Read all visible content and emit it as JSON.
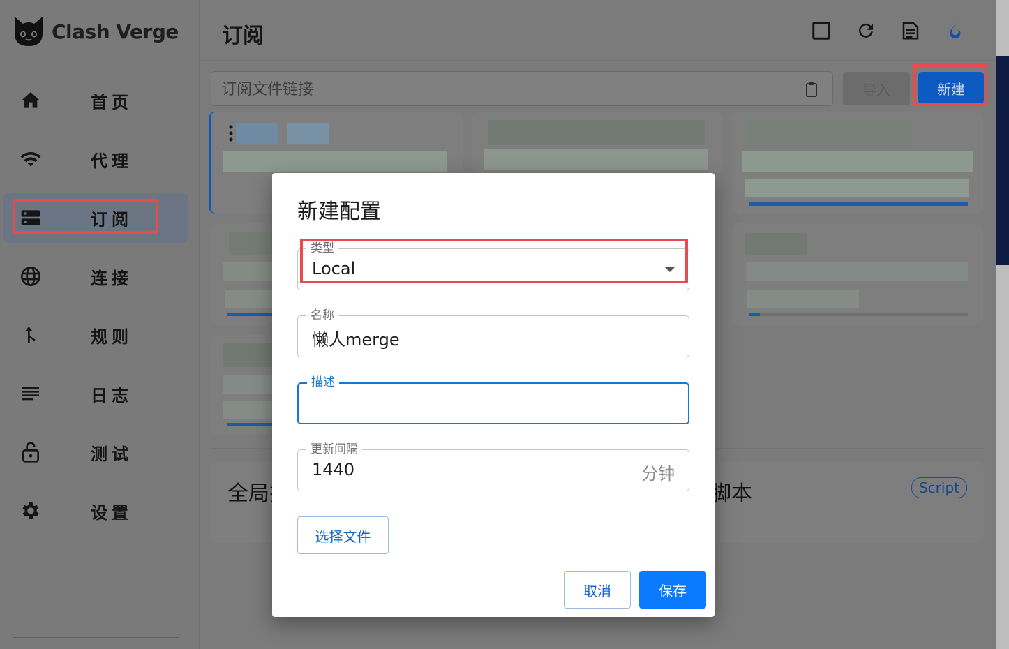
{
  "app": {
    "name": "Clash Verge",
    "page_title": "订阅"
  },
  "sidebar": {
    "items": [
      {
        "label": "首页",
        "icon": "home-icon"
      },
      {
        "label": "代理",
        "icon": "wifi-icon"
      },
      {
        "label": "订阅",
        "icon": "storage-icon",
        "active": true
      },
      {
        "label": "连接",
        "icon": "globe-icon"
      },
      {
        "label": "规则",
        "icon": "fork-icon"
      },
      {
        "label": "日志",
        "icon": "list-icon"
      },
      {
        "label": "测试",
        "icon": "lock-open-icon"
      },
      {
        "label": "设置",
        "icon": "gear-icon"
      }
    ]
  },
  "header": {
    "icons": [
      "square-icon",
      "refresh-icon",
      "document-icon",
      "fire-icon"
    ]
  },
  "toolbar": {
    "url_placeholder": "订阅文件链接",
    "import_label": "导入",
    "new_label": "新建"
  },
  "sections": {
    "global_left": "全局扩",
    "global_right": "脚本",
    "script_badge": "Script"
  },
  "dialog": {
    "title": "新建配置",
    "type_label": "类型",
    "type_value": "Local",
    "name_label": "名称",
    "name_value": "懒人merge",
    "desc_label": "描述",
    "desc_value": "",
    "interval_label": "更新间隔",
    "interval_value": "1440",
    "interval_unit": "分钟",
    "choose_file": "选择文件",
    "cancel": "取消",
    "save": "保存"
  },
  "colors": {
    "accent": "#1976d2",
    "primary_button": "#0a7aff",
    "highlight": "#e84a4f"
  }
}
